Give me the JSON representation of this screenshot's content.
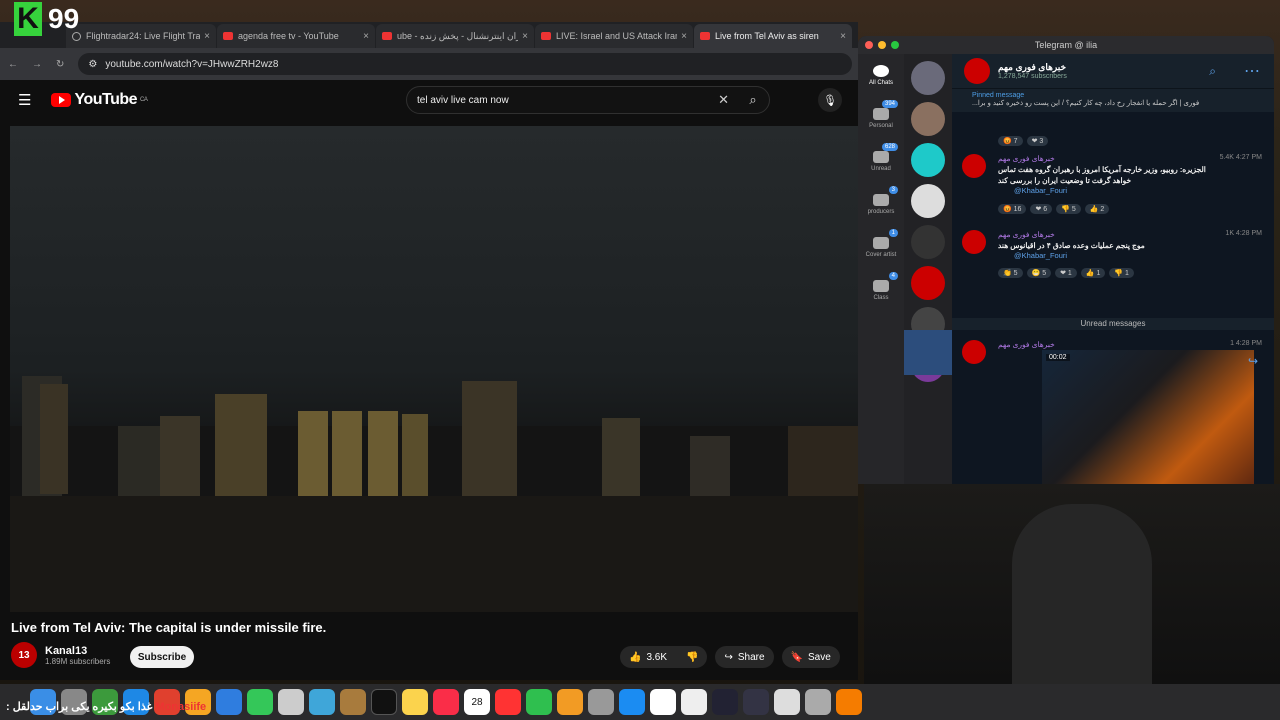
{
  "overlay": {
    "brand_letter": "K",
    "brand_number": "99",
    "ticker_name": "Monasiife",
    "ticker_text": "غذا بکو بکیره یکی براب حدلقل :"
  },
  "browser": {
    "tabs": [
      {
        "title": "Flightradar24: Live Flight Trac",
        "close": "×"
      },
      {
        "title": "agenda free tv - YouTube",
        "close": "×"
      },
      {
        "title": "ube - ایران اینترنشنال - پخش زنده",
        "close": "×"
      },
      {
        "title": "LIVE: Israel and US Attack Iran",
        "close": "×"
      },
      {
        "title": "Live from Tel Aviv as siren",
        "close": "×"
      }
    ],
    "url": "youtube.com/watch?v=JHwwZRH2wz8"
  },
  "youtube": {
    "logo": "YouTube",
    "region": "CA",
    "search_value": "tel aviv live cam now",
    "video_title": "Live from Tel Aviv: The capital is under missile fire.",
    "channel_name": "Kanal13",
    "channel_avatar": "13",
    "subscribers": "1.89M subscribers",
    "subscribe_label": "Subscribe",
    "likes": "3.6K",
    "share_label": "Share",
    "save_label": "Save"
  },
  "telegram": {
    "window_title": "Telegram @ ilia",
    "rail": [
      {
        "label": "All Chats",
        "badge": ""
      },
      {
        "label": "Personal",
        "badge": "394"
      },
      {
        "label": "Unread",
        "badge": "628"
      },
      {
        "label": "producers",
        "badge": "3"
      },
      {
        "label": "Cover artist",
        "badge": "1"
      },
      {
        "label": "Class",
        "badge": "4"
      }
    ],
    "channel_name": "خبرهای فوری مهم",
    "channel_subs": "1,278,547 subscribers",
    "pinned_label": "Pinned message",
    "pinned_text": "فوری | اگر حمله یا انفجار رخ داد، چه کار کنیم؟ / این پست رو ذخیره کنید و برا...",
    "messages": [
      {
        "from": "خبرهای فوری مهم",
        "meta": "5.4K 4:27 PM",
        "body": "الجزیره: روبیو، وزیر خارجه آمریکا امروز با رهبران گروه هفت تماس خواهد گرفت تا وضعیت ایران را بررسی کند",
        "link": "@Khabar_Fouri",
        "reactions": [
          "😡 16",
          "❤ 6",
          "👎 5",
          "👍 2"
        ]
      },
      {
        "from": "خبرهای فوری مهم",
        "meta": "1K 4:28 PM",
        "body": "موج پنجم عملیات وعده صادق ۴ در اقیانوس هند",
        "link": "@Khabar_Fouri",
        "reactions": [
          "👏 5",
          "😁 5",
          "❤ 1",
          "👍 1",
          "👎 1"
        ]
      }
    ],
    "top_reactions": [
      "😡 7",
      "❤ 3"
    ],
    "unread_label": "Unread messages",
    "video_msg": {
      "from": "خبرهای فوری مهم",
      "meta": "1 4:28 PM",
      "duration": "00:02"
    }
  },
  "dock": {
    "calendar_day": "28"
  }
}
